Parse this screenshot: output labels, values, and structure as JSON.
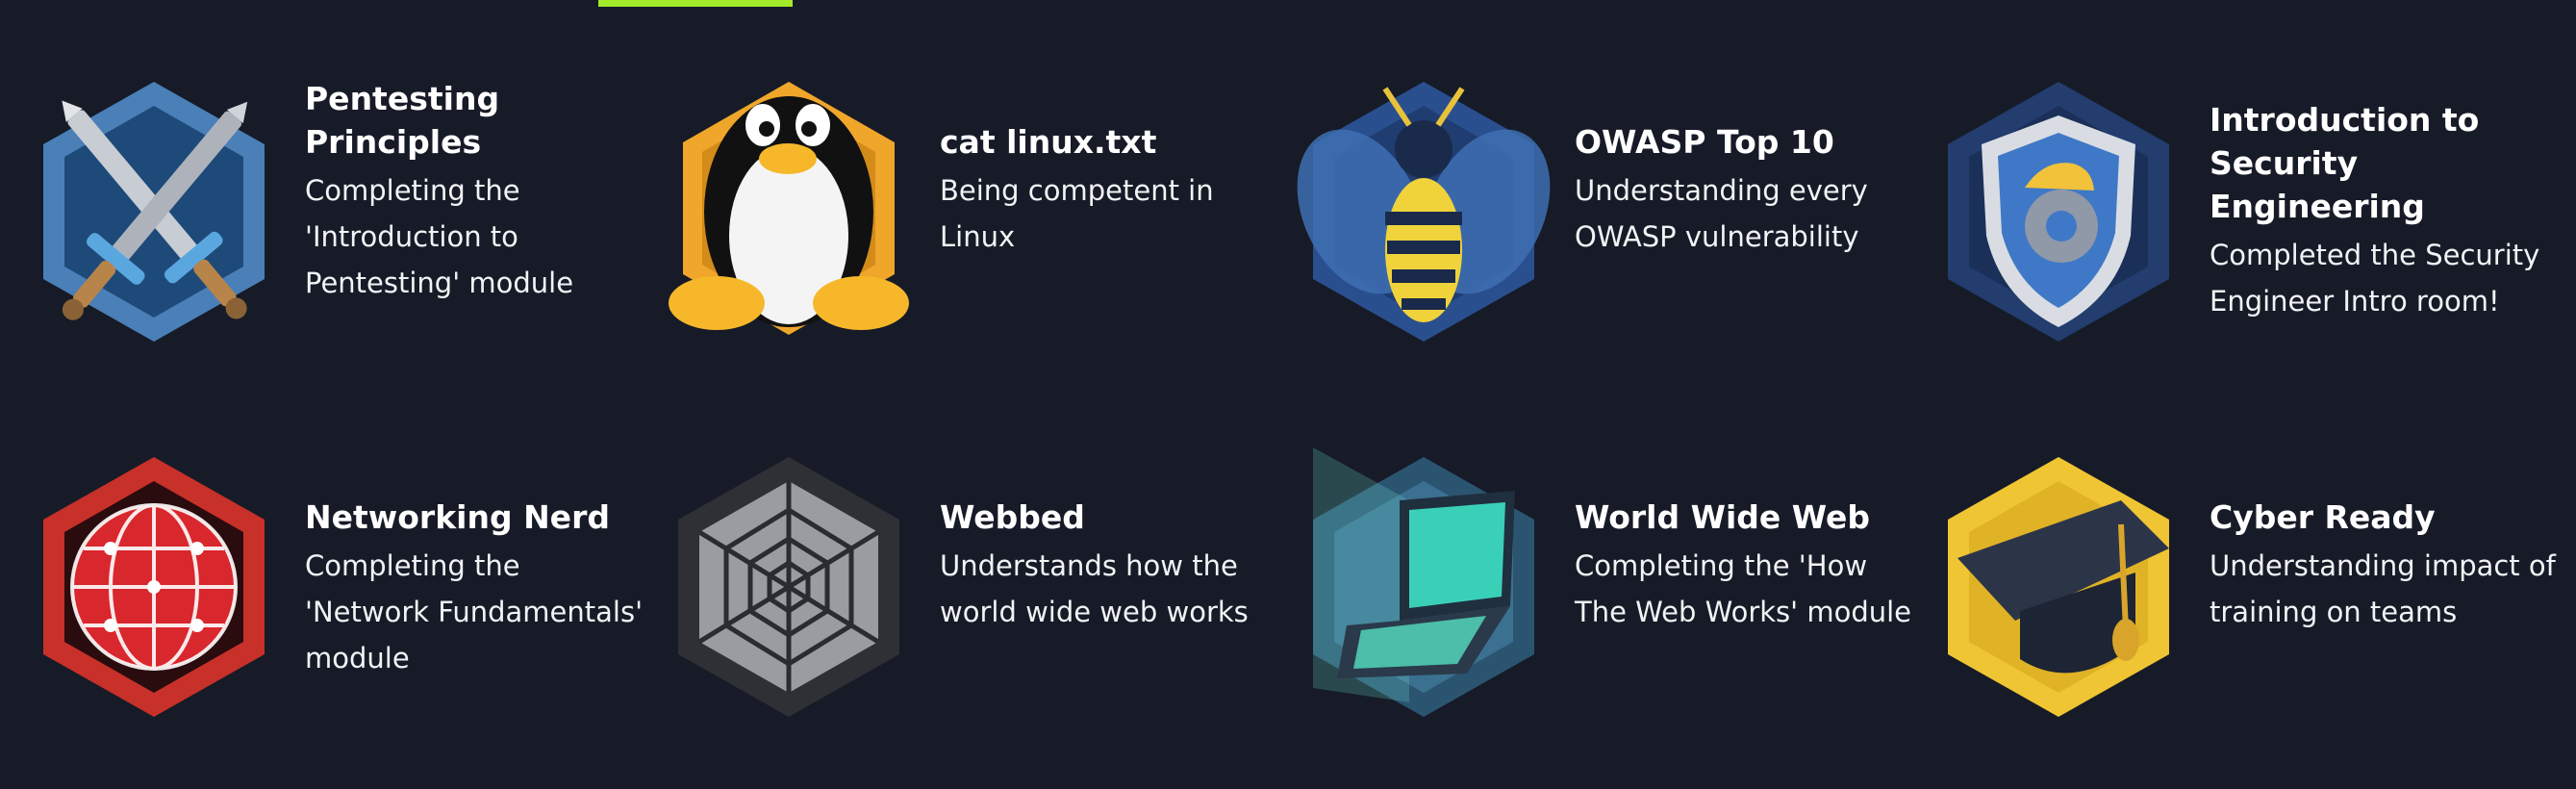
{
  "colors": {
    "background": "#161b27",
    "accent": "#a3ea2a",
    "text": "#ffffff"
  },
  "badges": [
    {
      "title": "Pentesting Principles",
      "description": "Completing the 'Introduction to Pentesting' module",
      "icon": "crossed-swords-icon"
    },
    {
      "title": "cat linux.txt",
      "description": "Being competent in Linux",
      "icon": "penguin-icon"
    },
    {
      "title": "OWASP Top 10",
      "description": "Understanding every OWASP vulnerability",
      "icon": "wasp-icon"
    },
    {
      "title": "Introduction to Security Engineering",
      "description": "Completed the Security Engineer Intro room!",
      "icon": "shield-gear-icon"
    },
    {
      "title": "Networking Nerd",
      "description": "Completing the 'Network Fundamentals' module",
      "icon": "network-globe-icon"
    },
    {
      "title": "Webbed",
      "description": "Understands how the world wide web works",
      "icon": "spider-web-icon"
    },
    {
      "title": "World Wide Web",
      "description": "Completing the 'How The Web Works' module",
      "icon": "laptop-icon"
    },
    {
      "title": "Cyber Ready",
      "description": "Understanding impact of training on teams",
      "icon": "graduation-cap-icon"
    }
  ]
}
